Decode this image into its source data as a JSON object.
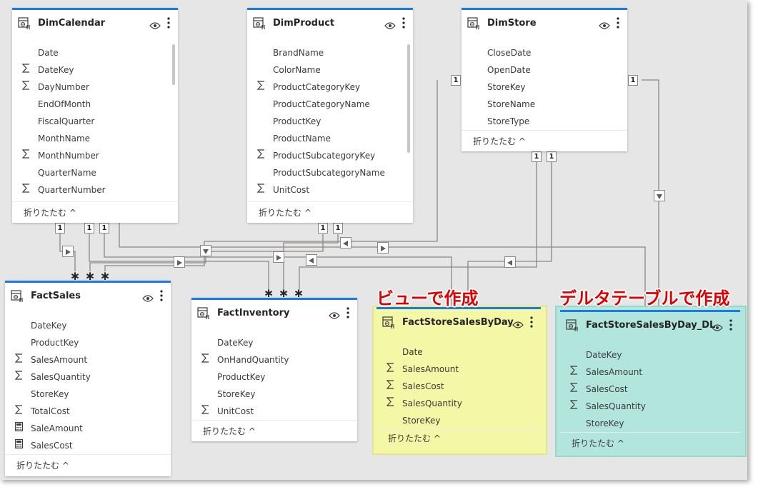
{
  "tables": {
    "dimcalendar": {
      "title": "DimCalendar",
      "fields": [
        {
          "name": "Date",
          "icon": ""
        },
        {
          "name": "DateKey",
          "icon": "sigma-icon"
        },
        {
          "name": "DayNumber",
          "icon": "sigma-icon"
        },
        {
          "name": "EndOfMonth",
          "icon": ""
        },
        {
          "name": "FiscalQuarter",
          "icon": ""
        },
        {
          "name": "MonthName",
          "icon": ""
        },
        {
          "name": "MonthNumber",
          "icon": "sigma-icon"
        },
        {
          "name": "QuarterName",
          "icon": ""
        },
        {
          "name": "QuarterNumber",
          "icon": "sigma-icon"
        }
      ],
      "collapse": "折りたたむ ^"
    },
    "dimproduct": {
      "title": "DimProduct",
      "fields": [
        {
          "name": "BrandName",
          "icon": ""
        },
        {
          "name": "ColorName",
          "icon": ""
        },
        {
          "name": "ProductCategoryKey",
          "icon": "sigma-icon"
        },
        {
          "name": "ProductCategoryName",
          "icon": ""
        },
        {
          "name": "ProductKey",
          "icon": ""
        },
        {
          "name": "ProductName",
          "icon": ""
        },
        {
          "name": "ProductSubcategoryKey",
          "icon": "sigma-icon"
        },
        {
          "name": "ProductSubcategoryName",
          "icon": ""
        },
        {
          "name": "UnitCost",
          "icon": "sigma-icon"
        }
      ],
      "collapse": "折りたたむ ^"
    },
    "dimstore": {
      "title": "DimStore",
      "fields": [
        {
          "name": "CloseDate",
          "icon": ""
        },
        {
          "name": "OpenDate",
          "icon": ""
        },
        {
          "name": "StoreKey",
          "icon": ""
        },
        {
          "name": "StoreName",
          "icon": ""
        },
        {
          "name": "StoreType",
          "icon": ""
        }
      ],
      "collapse": "折りたたむ ^"
    },
    "factsales": {
      "title": "FactSales",
      "fields": [
        {
          "name": "DateKey",
          "icon": ""
        },
        {
          "name": "ProductKey",
          "icon": ""
        },
        {
          "name": "SalesAmount",
          "icon": "sigma-icon"
        },
        {
          "name": "SalesQuantity",
          "icon": "sigma-icon"
        },
        {
          "name": "StoreKey",
          "icon": ""
        },
        {
          "name": "TotalCost",
          "icon": "sigma-icon"
        },
        {
          "name": "SaleAmount",
          "icon": "calculator-icon"
        },
        {
          "name": "SalesCost",
          "icon": "calculator-icon"
        }
      ],
      "collapse": "折りたたむ ^"
    },
    "factinventory": {
      "title": "FactInventory",
      "fields": [
        {
          "name": "DateKey",
          "icon": ""
        },
        {
          "name": "OnHandQuantity",
          "icon": "sigma-icon"
        },
        {
          "name": "ProductKey",
          "icon": ""
        },
        {
          "name": "StoreKey",
          "icon": ""
        },
        {
          "name": "UnitCost",
          "icon": "sigma-icon"
        }
      ],
      "collapse": "折りたたむ ^"
    },
    "factstoresalesbyday": {
      "title": "FactStoreSalesByDay",
      "fields": [
        {
          "name": "Date",
          "icon": ""
        },
        {
          "name": "SalesAmount",
          "icon": "sigma-icon"
        },
        {
          "name": "SalesCost",
          "icon": "sigma-icon"
        },
        {
          "name": "SalesQuantity",
          "icon": "sigma-icon"
        },
        {
          "name": "StoreKey",
          "icon": ""
        }
      ],
      "collapse": "折りたたむ ^"
    },
    "factstoresalesbyday_dl": {
      "title": "FactStoreSalesByDay_DL",
      "fields": [
        {
          "name": "DateKey",
          "icon": ""
        },
        {
          "name": "SalesAmount",
          "icon": "sigma-icon"
        },
        {
          "name": "SalesCost",
          "icon": "sigma-icon"
        },
        {
          "name": "SalesQuantity",
          "icon": "sigma-icon"
        },
        {
          "name": "StoreKey",
          "icon": ""
        }
      ],
      "collapse": "折りたたむ ^"
    }
  },
  "annotations": {
    "view": "ビューで作成",
    "delta": "デルタテーブルで作成"
  },
  "cardinality": {
    "one": "1",
    "many": "∗"
  },
  "colors": {
    "accent": "#1f7ae0",
    "view_highlight": "#f4f7a5",
    "delta_highlight": "#b2e6dc",
    "annotation": "#e00000"
  }
}
